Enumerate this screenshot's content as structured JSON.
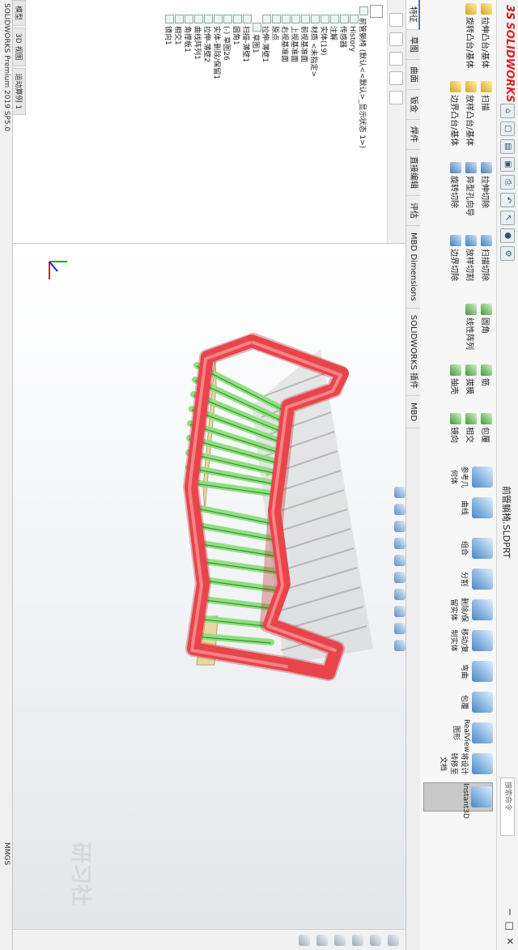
{
  "window": {
    "doc_title": "前管躺椅.SLDPRT",
    "search_placeholder": "搜索命令"
  },
  "ribbon": {
    "group1": [
      "拉伸凸台/基体",
      "旋转凸台/基体",
      "扫描",
      "放样凸台/基体",
      "边界凸台/基体"
    ],
    "group2": [
      "拉伸切除",
      "异型孔向导",
      "旋转切除",
      "扫描切除",
      "放样切割",
      "边界切除"
    ],
    "group3": [
      "圆角",
      "线性阵列",
      "筋",
      "拔模",
      "抽壳",
      "包覆",
      "相交",
      "镜向"
    ],
    "big_buttons": [
      "参考几何体",
      "曲线",
      "Instant3D",
      "组合",
      "分割",
      "删除/保留实体",
      "移动/复制实体",
      "弯曲",
      "包覆",
      "RealView 图形",
      "将设计转移至文档"
    ]
  },
  "tabs": [
    "特征",
    "草图",
    "曲面",
    "钣金",
    "焊件",
    "直接编辑",
    "评估",
    "MBD Dimensions",
    "SOLIDWORKS 插件",
    "MBD"
  ],
  "tree": {
    "items": [
      "前管躺椅 (默认<<默认>_显示状态 1>)",
      "History",
      "传感器",
      "注解",
      "实体(19)",
      "材质 <未指定>",
      "前视基准面",
      "上视基准面",
      "右视基准面",
      "原点",
      "拉伸-薄壁1",
      "草图1",
      "扫描-薄壁1",
      "圆角1",
      "(-) 草图26",
      "实体-删除/保留1",
      "拉伸-薄壁2",
      "曲线阵列1",
      "角撑板1",
      "相交1",
      "镜向1"
    ]
  },
  "bottom_tabs": [
    "模型",
    "3D 视图",
    "运动算例 1"
  ],
  "status": {
    "left": "SOLIDWORKS Premium 2019 SP5.0",
    "right": "MMGS"
  },
  "watermark": "研习社",
  "colors": {
    "frame_tube": "#e8454a",
    "slat": "#8fe07f",
    "accent": "#3a78c2"
  }
}
